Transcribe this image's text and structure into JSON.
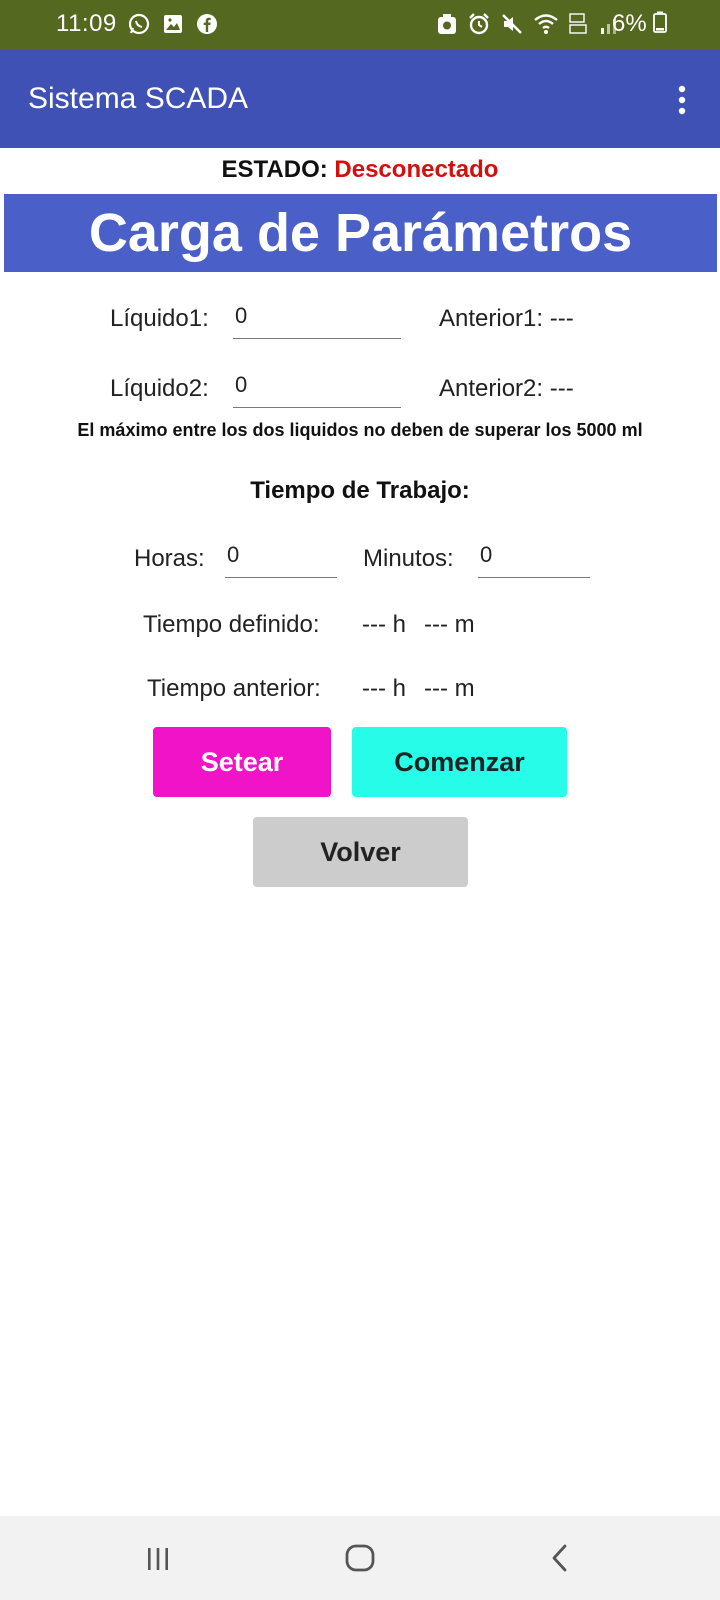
{
  "status_bar": {
    "time": "11:09",
    "battery": "6%",
    "icons": [
      "whatsapp-icon",
      "gallery-icon",
      "facebook-icon",
      "data-saver-icon",
      "alarm-icon",
      "mute-icon",
      "wifi-icon",
      "volte-icon",
      "signal-icon",
      "battery-icon"
    ]
  },
  "app_bar": {
    "title": "Sistema SCADA",
    "menu_icon": "more-vert-icon"
  },
  "estado": {
    "label": "ESTADO:",
    "value": "Desconectado",
    "value_color": "#d30f0f"
  },
  "banner": {
    "title": "Carga de Parámetros",
    "color": "#4a5fc7"
  },
  "liquidos": [
    {
      "label": "Líquido1:",
      "value": "0",
      "anterior": "Anterior1: ---"
    },
    {
      "label": "Líquido2:",
      "value": "0",
      "anterior": "Anterior2: ---"
    }
  ],
  "note": "El máximo entre los dos liquidos no deben de superar los 5000 ml",
  "tiempo": {
    "title": "Tiempo de Trabajo:",
    "horas_label": "Horas:",
    "horas_value": "0",
    "minutos_label": "Minutos:",
    "minutos_value": "0",
    "definido_label": "Tiempo definido:",
    "definido_h": "--- h",
    "definido_m": "--- m",
    "anterior_label": "Tiempo anterior:",
    "anterior_h": "--- h",
    "anterior_m": "--- m"
  },
  "buttons": {
    "setear": "Setear",
    "comenzar": "Comenzar",
    "volver": "Volver",
    "setear_color": "#f013c8",
    "comenzar_color": "#26fce8",
    "volver_color": "#cccccc"
  },
  "nav_bar": {
    "icons": [
      "recent-apps-icon",
      "home-icon",
      "back-icon"
    ]
  }
}
